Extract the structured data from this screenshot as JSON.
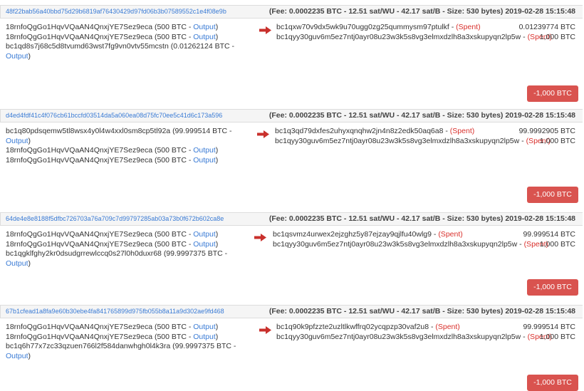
{
  "transactions": [
    {
      "hash": "48f22bab56a40bbd75d29b6819af76430429d97fd06b3b07589552c1e4f08e9b",
      "fee_info": "(Fee: 0.0002235 BTC - 12.51 sat/WU - 42.17 sat/B - Size: 530 bytes) 2019-02-28 15:15:48",
      "inputs": [
        {
          "address": "18rnfoQgGo1HqvVQaAN4QnxjYE7Sez9eca",
          "amount": "(500 BTC -",
          "link": "Output",
          "close": ")"
        },
        {
          "address": "18rnfoQgGo1HqvVQaAN4QnxjYE7Sez9eca",
          "amount": "(500 BTC -",
          "link": "Output",
          "close": ")"
        },
        {
          "address": "bc1qd8s7j68c5d8tvumd63wst7fg9vn0vtv55mcstn",
          "amount": "(0.01262124 BTC -",
          "link": "Output",
          "close": ")"
        }
      ],
      "outputs": [
        {
          "address": "bc1qxw70v9dx5wk9u70ugg0zg25qummysm97ptulkf",
          "status": "(Spent)",
          "amount": "0.01239774 BTC"
        },
        {
          "address": "bc1qyy30guv6m5ez7ntj0ayr08u23w3k5s8vg3elmxdzlh8a3xskupyqn2lp5w",
          "status": "(Spent)",
          "amount": "1,000 BTC"
        }
      ],
      "total": "-1,000 BTC"
    },
    {
      "hash": "d4ed4fdf41c4f076cb61bccfd03514da5a060ea08d75fc70ee5c41d6c173a596",
      "fee_info": "(Fee: 0.0002235 BTC - 12.51 sat/WU - 42.17 sat/B - Size: 530 bytes) 2019-02-28 15:15:48",
      "inputs": [
        {
          "address": "bc1q80pdsqemw5tl8wsx4y0l4w4xxl0sm8cp5tl92a",
          "amount": "(99.999514 BTC -",
          "link": "Output",
          "close": ")"
        },
        {
          "address": "18rnfoQgGo1HqvVQaAN4QnxjYE7Sez9eca",
          "amount": "(500 BTC -",
          "link": "Output",
          "close": ")"
        },
        {
          "address": "18rnfoQgGo1HqvVQaAN4QnxjYE7Sez9eca",
          "amount": "(500 BTC -",
          "link": "Output",
          "close": ")"
        }
      ],
      "outputs": [
        {
          "address": "bc1q3qd79dxfes2uhyxqnqhw2jn4n8z2edk50aq6a8",
          "status": "(Spent)",
          "amount": "99.9992905 BTC"
        },
        {
          "address": "bc1qyy30guv6m5ez7ntj0ayr08u23w3k5s8vg3elmxdzlh8a3xskupyqn2lp5w",
          "status": "(Spent)",
          "amount": "1,000 BTC"
        }
      ],
      "total": "-1,000 BTC"
    },
    {
      "hash": "64de4e8e8188f5dfbc726703a76a709c7d99797285ab03a73b0f672b602ca8e",
      "fee_info": "(Fee: 0.0002235 BTC - 12.51 sat/WU - 42.17 sat/B - Size: 530 bytes) 2019-02-28 15:15:48",
      "inputs": [
        {
          "address": "18rnfoQgGo1HqvVQaAN4QnxjYE7Sez9eca",
          "amount": "(500 BTC -",
          "link": "Output",
          "close": ")"
        },
        {
          "address": "18rnfoQgGo1HqvVQaAN4QnxjYE7Sez9eca",
          "amount": "(500 BTC -",
          "link": "Output",
          "close": ")"
        },
        {
          "address": "bc1qgklfghy2kr0dsudgrrewlccq0s27l0h0duxr68",
          "amount": "(99.9997375 BTC -",
          "link": "Output",
          "close": ")"
        }
      ],
      "outputs": [
        {
          "address": "bc1qsvmz4urwex2ejzghz5y87ejzay9qjlfu40wlg9",
          "status": "(Spent)",
          "amount": "99.999514 BTC"
        },
        {
          "address": "bc1qyy30guv6m5ez7ntj0ayr08u23w3k5s8vg3elmxdzlh8a3xskupyqn2lp5w",
          "status": "(Spent)",
          "amount": "1,000 BTC"
        }
      ],
      "total": "-1,000 BTC"
    },
    {
      "hash": "67b1cfead1a8fa9e60b30ebe4fa841765899d975fb055b8a11a9d302ae9fd468",
      "fee_info": "(Fee: 0.0002235 BTC - 12.51 sat/WU - 42.17 sat/B - Size: 530 bytes) 2019-02-28 15:15:48",
      "inputs": [
        {
          "address": "18rnfoQgGo1HqvVQaAN4QnxjYE7Sez9eca",
          "amount": "(500 BTC -",
          "link": "Output",
          "close": ")"
        },
        {
          "address": "18rnfoQgGo1HqvVQaAN4QnxjYE7Sez9eca",
          "amount": "(500 BTC -",
          "link": "Output",
          "close": ")"
        },
        {
          "address": "bc1q6h77x7zc33qzuen766l2f584danwhgh0l4k3ra",
          "amount": "(99.9997375 BTC -",
          "link": "Output",
          "close": ")"
        }
      ],
      "outputs": [
        {
          "address": "bc1q90k9pfzzte2uzltlkwffrq02ycqpzp30vaf2u8",
          "status": "(Spent)",
          "amount": "99.999514 BTC"
        },
        {
          "address": "bc1qyy30guv6m5ez7ntj0ayr08u23w3k5s8vg3elmxdzlh8a3xskupyqn2lp5w",
          "status": "(Spent)",
          "amount": "1,000 BTC"
        }
      ],
      "total": "-1,000 BTC"
    }
  ],
  "colors": {
    "link": "#3a7bd5",
    "spent": "#d9302c",
    "arrow": "#c9302c",
    "button": "#d9534f"
  },
  "icons": {
    "direction": "arrow-right-icon"
  }
}
